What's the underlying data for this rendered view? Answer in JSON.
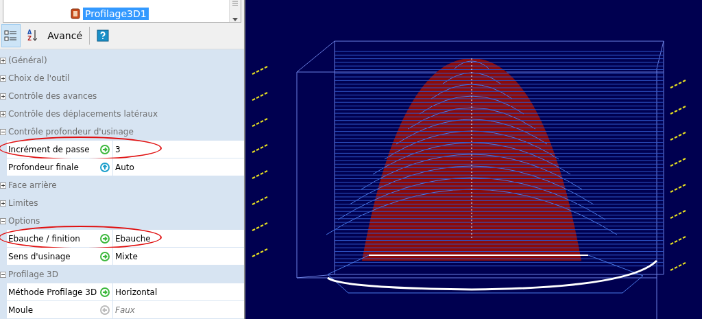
{
  "tree": {
    "items": [
      {
        "label": "Profilage3D1",
        "selected": true
      }
    ]
  },
  "toolbar": {
    "buttons": [
      {
        "kind": "categorized",
        "selected": true
      },
      {
        "kind": "alphabetical",
        "letters": [
          "A",
          "Z"
        ],
        "selected": false
      },
      {
        "kind": "text",
        "label": "Avancé",
        "selected": false
      },
      {
        "kind": "help",
        "selected": false
      }
    ]
  },
  "properties": [
    {
      "label": "(Général)",
      "expanded": false
    },
    {
      "label": "Choix de l'outil",
      "expanded": false
    },
    {
      "label": "Contrôle des avances",
      "expanded": false
    },
    {
      "label": "Contrôle des déplacements latéraux",
      "expanded": false
    },
    {
      "label": "Contrôle profondeur d'usinage",
      "expanded": true,
      "rows": [
        {
          "label": "Incrément de passe",
          "kind": "set",
          "value": "3",
          "highlighted": true
        },
        {
          "label": "Profondeur finale",
          "kind": "auto",
          "value": "Auto",
          "highlighted": false
        }
      ]
    },
    {
      "label": "Face arrière",
      "expanded": false
    },
    {
      "label": "Limites",
      "expanded": false
    },
    {
      "label": "Options",
      "expanded": true,
      "rows": [
        {
          "label": "Ebauche / finition",
          "kind": "set",
          "value": "Ebauche",
          "highlighted": true
        },
        {
          "label": "Sens d'usinage",
          "kind": "set",
          "value": "Mixte",
          "highlighted": false
        }
      ]
    },
    {
      "label": "Profilage 3D",
      "expanded": true,
      "rows": [
        {
          "label": "Méthode Profilage 3D",
          "kind": "set",
          "value": "Horizontal",
          "highlighted": false
        },
        {
          "label": "Moule",
          "kind": "inactive",
          "value": "Faux",
          "highlighted": false
        }
      ]
    }
  ]
}
